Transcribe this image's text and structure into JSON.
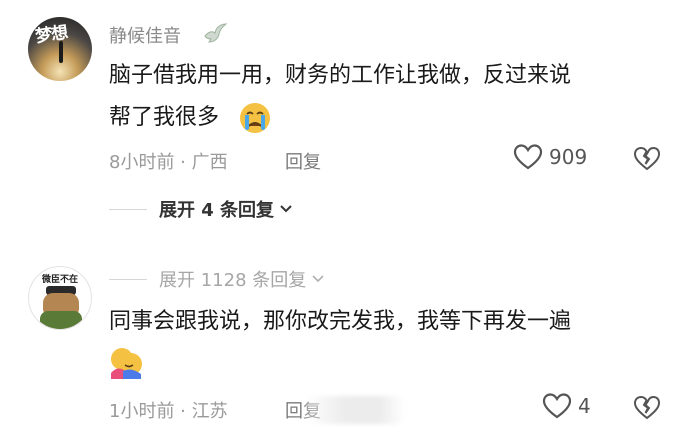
{
  "comments": [
    {
      "username": "静候佳音",
      "avatar_text": "梦想",
      "text_line1": "脑子借我用一用，财务的工作让我做，反过来说",
      "text_line2": "帮了我很多",
      "emoji": "crying-face-emoji",
      "time_location": "8小时前 · 广西",
      "reply_label": "回复",
      "likes": "909",
      "expand_label": "展开 4 条回复"
    },
    {
      "avatar_text": "微臣不在",
      "expand_label": "展开 1128 条回复",
      "text_line1": "同事会跟我说，那你改完发我，我等下再发一遍",
      "emoji": "hugging-face-emoji",
      "time_location": "1小时前 · 江苏",
      "reply_label": "回复",
      "likes": "4"
    }
  ],
  "colors": {
    "meta_gray": "#9a9a9a",
    "text": "#1a1a1a",
    "emoji_yellow": "#f5c142",
    "tear_blue": "#4aa8e8"
  },
  "icons": [
    "dove-icon",
    "heart-icon",
    "broken-heart-icon",
    "chevron-down-icon"
  ]
}
